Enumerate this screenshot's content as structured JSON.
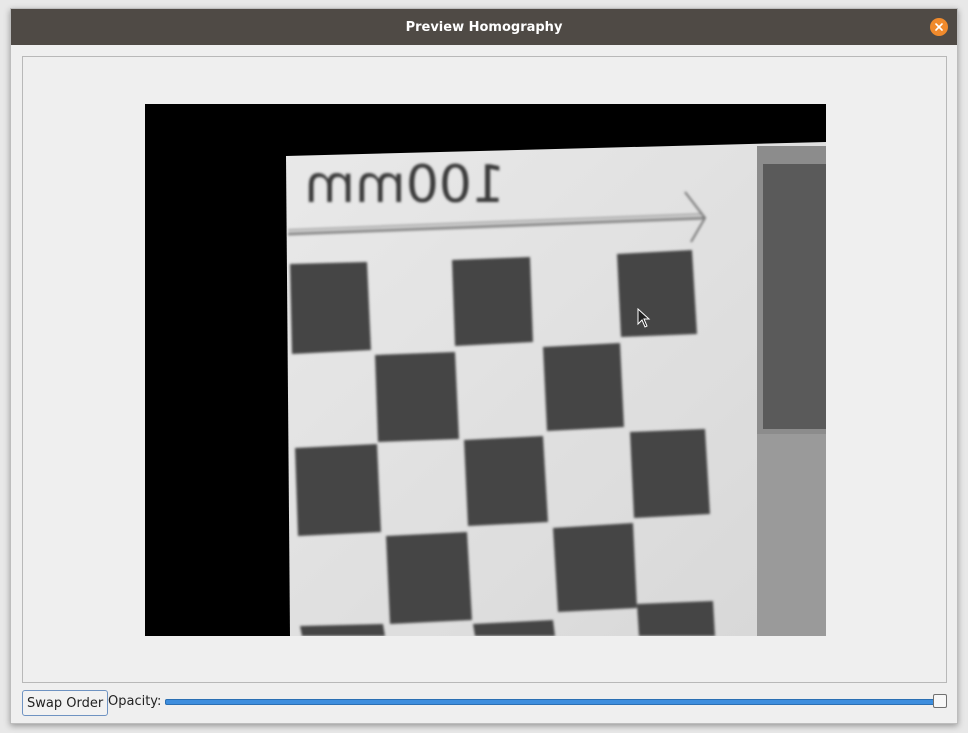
{
  "window": {
    "title": "Preview Homography",
    "close_icon": "close-icon",
    "accent_close": "#f08a2c",
    "titlebar_color": "#4f4a45"
  },
  "preview": {
    "warped_text": "100mm",
    "content": "warped-checkerboard-image"
  },
  "controls": {
    "swap_label": "Swap Order",
    "opacity_label": "Opacity:",
    "opacity_value": 1.0
  }
}
